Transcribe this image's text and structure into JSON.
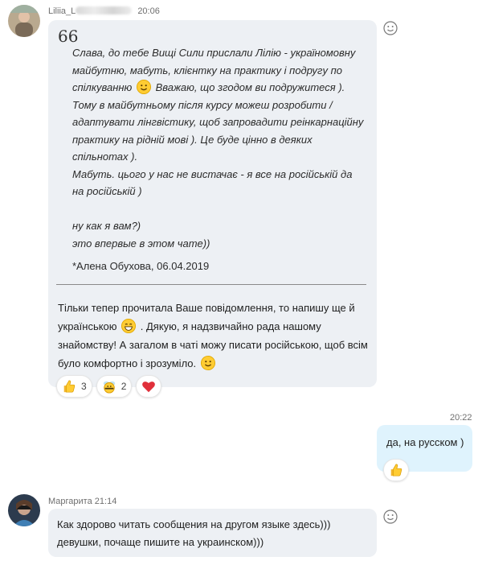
{
  "messages": {
    "first": {
      "sender": "Liliia_L",
      "time": "20:06",
      "quote_mark": "66",
      "quote_lines": [
        "Слава, до тебе Вищі Сили прислали Лілію - україномовну",
        "майбутню, мабуть, клієнтку на практику і подругу по",
        "спілкуванню [smile] Вважаю, що згодом ви подружитеся ).",
        "Тому в майбутньому після курсу можеш розробити /",
        "адаптувати лінгвістику, щоб  запровадити реінкарнаційну",
        "практику на рідній мові ). Це буде цінно в деяких",
        "спільнотах ).",
        "Мабуть. цього у нас не вистачає - я все на російській да",
        "на російській )",
        "",
        "ну как я вам?)",
        "это впервые в этом чате))"
      ],
      "quote_line3_before": "спілкуванню",
      "quote_line3_after": "Вважаю, що згодом ви подружитеся ).",
      "quote_author": "*Алена Обухова, 06.04.2019",
      "reply_part1": "Тільки тепер прочитала Ваше повідомлення, то напишу ще й українською",
      "reply_part2": ". Дякую, я надзвичайно рада нашому знайомству! А загалом в чаті можу писати російською, щоб всім було комфортно і зрозуміло.",
      "reactions": [
        {
          "icon": "thumbs-up-icon",
          "count": "3"
        },
        {
          "icon": "wasp-emoji-icon",
          "count": "2"
        },
        {
          "icon": "heart-icon",
          "count": ""
        }
      ]
    },
    "second": {
      "time": "20:22",
      "text": "да, на русском )",
      "reaction_icon": "thumbs-up-icon"
    },
    "third": {
      "sender": "Маргарита",
      "time": "21:14",
      "text": "Как здорово читать сообщения на другом языке здесь))) девушки, почаще пишите на украинском)))"
    }
  },
  "colors": {
    "incoming_bubble": "#edf0f4",
    "outgoing_bubble": "#dff3fd",
    "heart": "#e0303a",
    "emoji_yellow": "#ffcc33"
  }
}
